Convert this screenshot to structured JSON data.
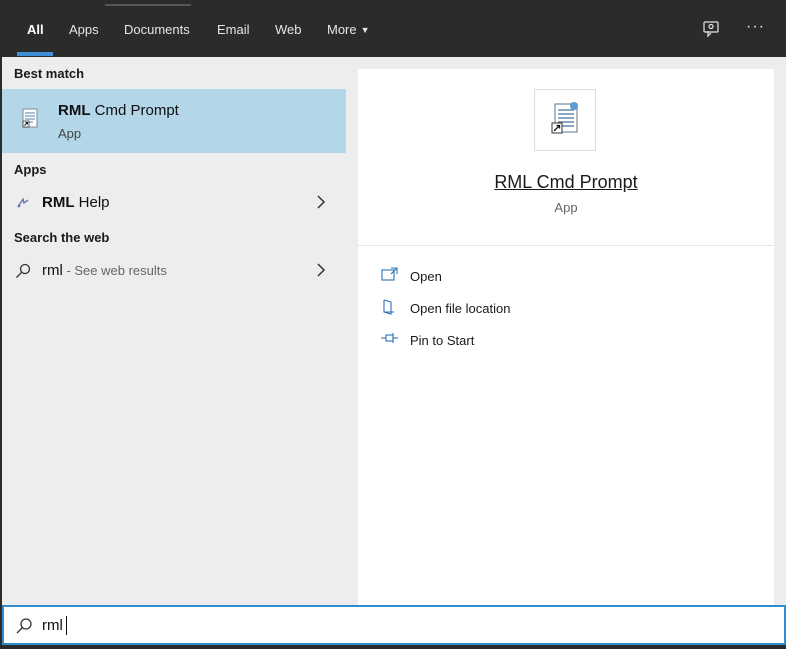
{
  "tabs": [
    {
      "label": "All"
    },
    {
      "label": "Apps"
    },
    {
      "label": "Documents"
    },
    {
      "label": "Email"
    },
    {
      "label": "Web"
    },
    {
      "label": "More"
    }
  ],
  "left": {
    "best_match_label": "Best match",
    "best_match": {
      "title_bold": "RML",
      "title_rest": " Cmd Prompt",
      "subtitle": "App"
    },
    "apps_label": "Apps",
    "apps": [
      {
        "label_bold": "RML",
        "label_rest": " Help"
      }
    ],
    "web_label": "Search the web",
    "web_result": {
      "query": "rml",
      "suffix": " - See web results"
    }
  },
  "detail": {
    "title": "RML Cmd Prompt",
    "subtitle": "App",
    "actions": [
      {
        "label": "Open",
        "icon": "open-icon"
      },
      {
        "label": "Open file location",
        "icon": "file-location-icon"
      },
      {
        "label": "Pin to Start",
        "icon": "pin-icon"
      }
    ]
  },
  "search": {
    "value": "rml"
  },
  "colors": {
    "topbar": "#2b2b2b",
    "accent": "#3d8fd6",
    "selected_row": "#b3d6e8",
    "pane": "#ededed",
    "search_border": "#2e8ccf"
  }
}
